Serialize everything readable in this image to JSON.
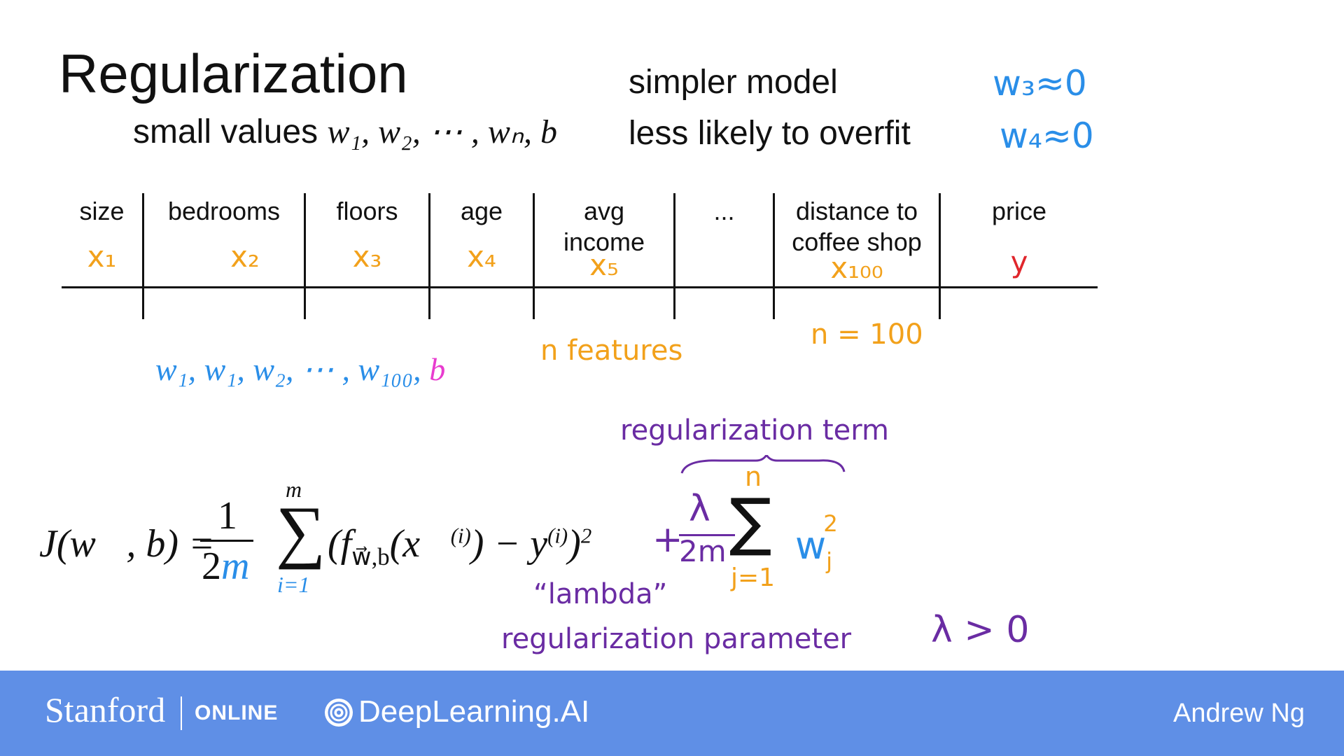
{
  "title": "Regularization",
  "subtitle_text": "small values",
  "subtitle_math": "w₁, w₂, ⋯ , wₙ, b",
  "notes": {
    "simpler_model": "simpler model",
    "less_overfit": "less likely to overfit",
    "w3": "w₃≈0",
    "w4": "w₄≈0"
  },
  "table": {
    "headers": [
      "size",
      "bedrooms",
      "floors",
      "age",
      "avg\nincome",
      "...",
      "distance to\ncoffee shop",
      "price"
    ],
    "features": [
      "x₁",
      "x₂",
      "x₃",
      "x₄",
      "x₅",
      "",
      "x₁₀₀",
      "y"
    ]
  },
  "annotations": {
    "weights_list": "w₁, w₁, w₂, ⋯ , w₁₀₀,",
    "bias": "b",
    "n_features": "n features",
    "n_value": "n = 100",
    "reg_term": "regularization term",
    "lambda_quote": "“lambda”",
    "reg_param": "regularization parameter",
    "lambda_pos": "λ > 0"
  },
  "formula": {
    "lhs": "J(w⃗, b) =",
    "frac_num": "1",
    "frac_den_2": "2",
    "frac_den_m": "m",
    "sum_top": "m",
    "sum_bottom": "i=1",
    "body": "(f",
    "body_sub": "w⃗,b",
    "body_rest": "(x⃗",
    "sup_i": "(i)",
    "minus_y": ") − y",
    "close": ")",
    "square": "2",
    "plus": "+",
    "lam_num": "λ",
    "lam_den": "2m",
    "sum2_top": "n",
    "sum2_bottom": "j=1",
    "wj": "w",
    "wj_sub": "j",
    "wj_sup": "2"
  },
  "footer": {
    "stanford": "Stanford",
    "online": "ONLINE",
    "deeplearning": "DeepLearning.AI",
    "author": "Andrew Ng"
  },
  "colors": {
    "footer_bg": "#5f8fe6",
    "blue": "#2a8ee8",
    "orange": "#f2a11b",
    "red": "#e0262c",
    "purple": "#6a2ca3",
    "magenta": "#e83ccf"
  }
}
